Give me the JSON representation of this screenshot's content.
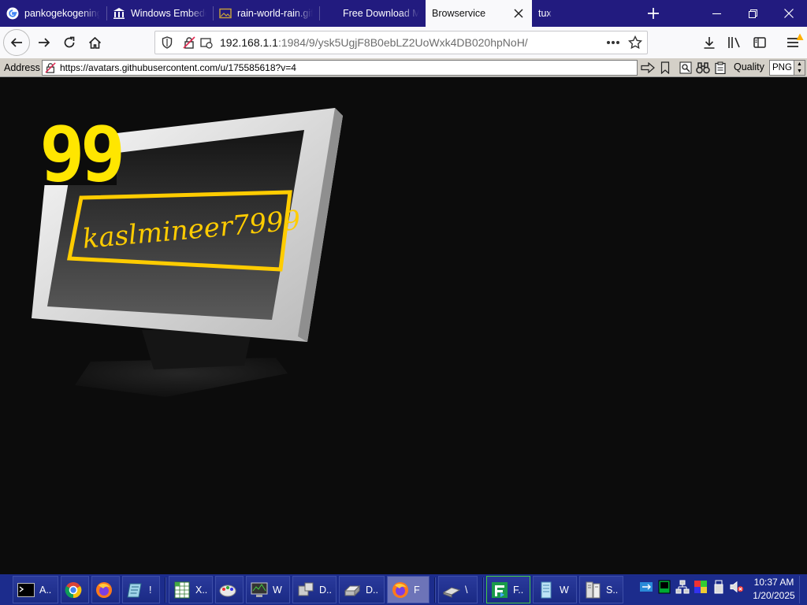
{
  "tabs": [
    {
      "title": "pankogekogening",
      "icon": "google-icon",
      "active": false
    },
    {
      "title": "Windows Embedded",
      "icon": "institution-icon",
      "active": false
    },
    {
      "title": "rain-world-rain.gif",
      "icon": "image-icon",
      "active": false
    },
    {
      "title": "Free Download Manager",
      "icon": "",
      "active": false
    },
    {
      "title": "Browservice",
      "icon": "",
      "active": true
    },
    {
      "title": "tux",
      "icon": "",
      "active": false
    }
  ],
  "url": {
    "host": "192.168.1.1",
    "rest": ":1984/9/ysk5UgjF8B0ebLZ2UoWxk4DB020hpNoH/"
  },
  "address_bar": {
    "label": "Address",
    "value": "https://avatars.githubusercontent.com/u/175585618?v=4",
    "quality_label": "Quality",
    "quality_value": "PNG"
  },
  "content": {
    "badge_text": "99",
    "username": "kaslmineer7999"
  },
  "taskbar": {
    "items": [
      {
        "label": "A..",
        "icon": "terminal-icon",
        "active": false
      },
      {
        "label": "",
        "icon": "chrome-icon",
        "active": false
      },
      {
        "label": "",
        "icon": "firefox-icon",
        "active": false
      },
      {
        "label": "!",
        "icon": "notepad-icon",
        "active": false
      },
      {
        "label": "X..",
        "icon": "spreadsheet-icon",
        "active": false
      },
      {
        "label": "",
        "icon": "paint-icon",
        "active": false
      },
      {
        "label": "W",
        "icon": "monitor-app-icon",
        "active": false
      },
      {
        "label": "D..",
        "icon": "computer-icon",
        "active": false
      },
      {
        "label": "D..",
        "icon": "drive-icon",
        "active": false
      },
      {
        "label": "F",
        "icon": "firefox-icon",
        "active": true
      },
      {
        "label": "\\",
        "icon": "network-drive-icon",
        "active": false
      },
      {
        "label": "F..",
        "icon": "file-manager-icon",
        "active": false
      },
      {
        "label": "W",
        "icon": "document-icon",
        "active": false
      },
      {
        "label": "S..",
        "icon": "server-icon",
        "active": false
      }
    ],
    "time": "10:37 AM",
    "date": "1/20/2025"
  }
}
